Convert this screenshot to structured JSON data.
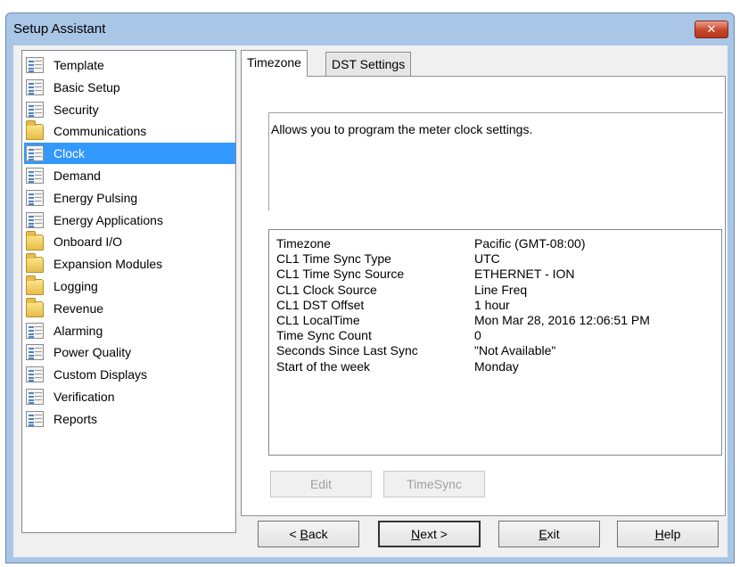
{
  "window": {
    "title": "Setup Assistant",
    "close_icon": "close-icon"
  },
  "tree": {
    "items": [
      {
        "label": "Template",
        "icon": "document-icon"
      },
      {
        "label": "Basic Setup",
        "icon": "document-icon"
      },
      {
        "label": "Security",
        "icon": "document-icon"
      },
      {
        "label": "Communications",
        "icon": "folder-icon"
      },
      {
        "label": "Clock",
        "icon": "document-icon",
        "selected": true
      },
      {
        "label": "Demand",
        "icon": "document-icon"
      },
      {
        "label": "Energy Pulsing",
        "icon": "document-icon"
      },
      {
        "label": "Energy Applications",
        "icon": "document-icon"
      },
      {
        "label": "Onboard I/O",
        "icon": "folder-icon"
      },
      {
        "label": "Expansion Modules",
        "icon": "folder-icon"
      },
      {
        "label": "Logging",
        "icon": "folder-icon"
      },
      {
        "label": "Revenue",
        "icon": "folder-icon"
      },
      {
        "label": "Alarming",
        "icon": "document-icon"
      },
      {
        "label": "Power Quality",
        "icon": "document-icon"
      },
      {
        "label": "Custom Displays",
        "icon": "document-icon"
      },
      {
        "label": "Verification",
        "icon": "document-icon"
      },
      {
        "label": "Reports",
        "icon": "document-icon"
      }
    ]
  },
  "tabs": [
    {
      "label": "Timezone",
      "active": true
    },
    {
      "label": "DST Settings",
      "active": false
    }
  ],
  "description": "Allows you to program the meter clock settings.",
  "properties": [
    {
      "key": "Timezone",
      "value": "Pacific (GMT-08:00)"
    },
    {
      "key": "CL1 Time Sync Type",
      "value": "UTC"
    },
    {
      "key": "CL1 Time Sync Source",
      "value": "ETHERNET - ION"
    },
    {
      "key": "CL1 Clock Source",
      "value": "Line Freq"
    },
    {
      "key": "CL1 DST Offset",
      "value": "1 hour"
    },
    {
      "key": "CL1 LocalTime",
      "value": "Mon Mar 28, 2016 12:06:51 PM"
    },
    {
      "key": "Time Sync Count",
      "value": "0"
    },
    {
      "key": "Seconds Since Last Sync",
      "value": "\"Not Available\""
    },
    {
      "key": "Start of the week",
      "value": "Monday"
    }
  ],
  "panel_buttons": {
    "edit": "Edit",
    "timesync": "TimeSync"
  },
  "footer": {
    "back_prefix": "< ",
    "back_mnemonic": "B",
    "back_rest": "ack",
    "next_mnemonic": "N",
    "next_rest": "ext >",
    "exit_mnemonic": "E",
    "exit_rest": "xit",
    "help_mnemonic": "H",
    "help_rest": "elp"
  },
  "colors": {
    "titlebar": "#a9c6e7",
    "selection": "#3399ff",
    "close_button": "#c8462c"
  }
}
